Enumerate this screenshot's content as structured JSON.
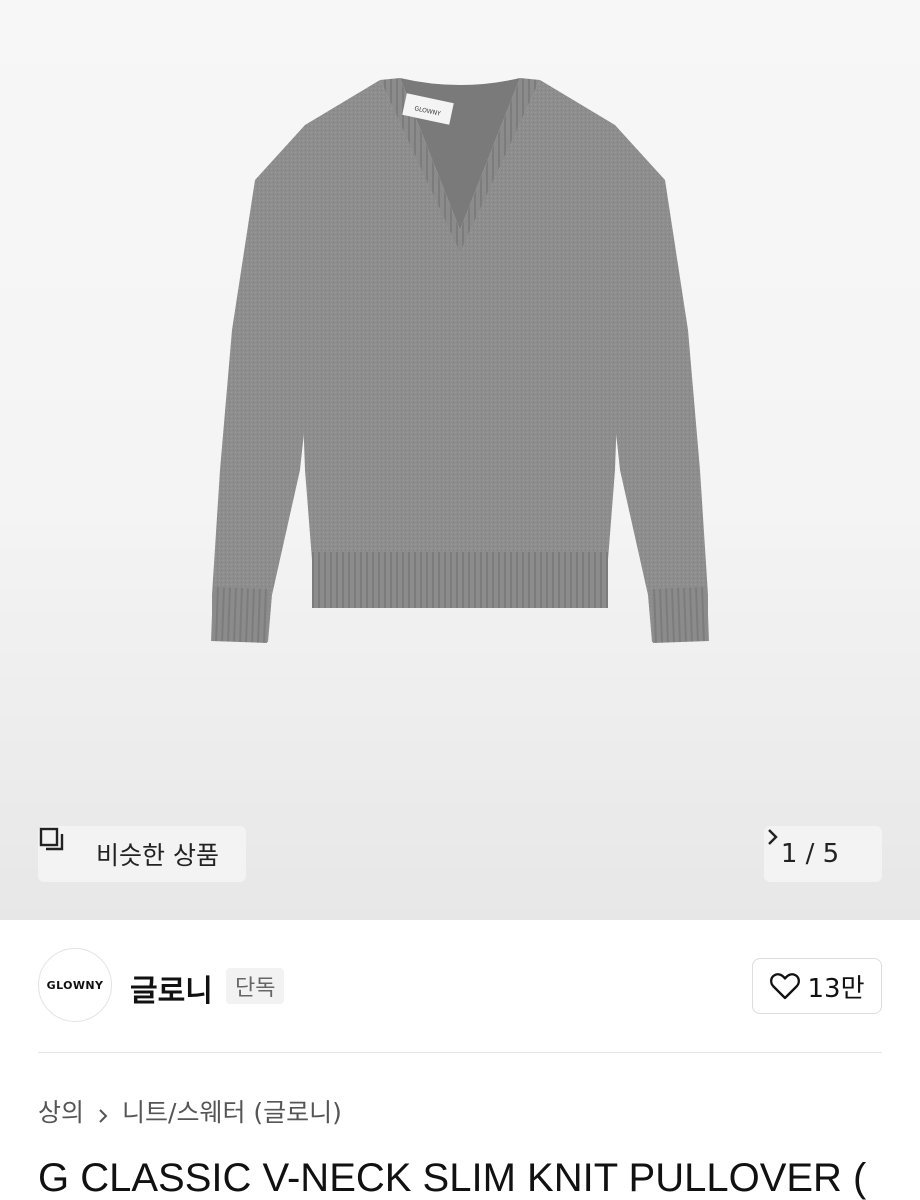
{
  "gallery": {
    "similar_label": "비슷한 상품",
    "counter": "1 / 5",
    "garment_label": "GLOWNY"
  },
  "brand": {
    "logo_text": "GLOWNY",
    "name": "글로니",
    "tag": "단독",
    "likes": "13만"
  },
  "breadcrumb": {
    "items": [
      "상의",
      "니트/스웨터 (글로니)"
    ]
  },
  "product": {
    "title": "G CLASSIC V-NECK SLIM KNIT PULLOVER ("
  },
  "colors": {
    "sweater": "#8c8c8c",
    "hero_bg": "#f4f4f4",
    "chip_bg": "#f3f3f3"
  }
}
